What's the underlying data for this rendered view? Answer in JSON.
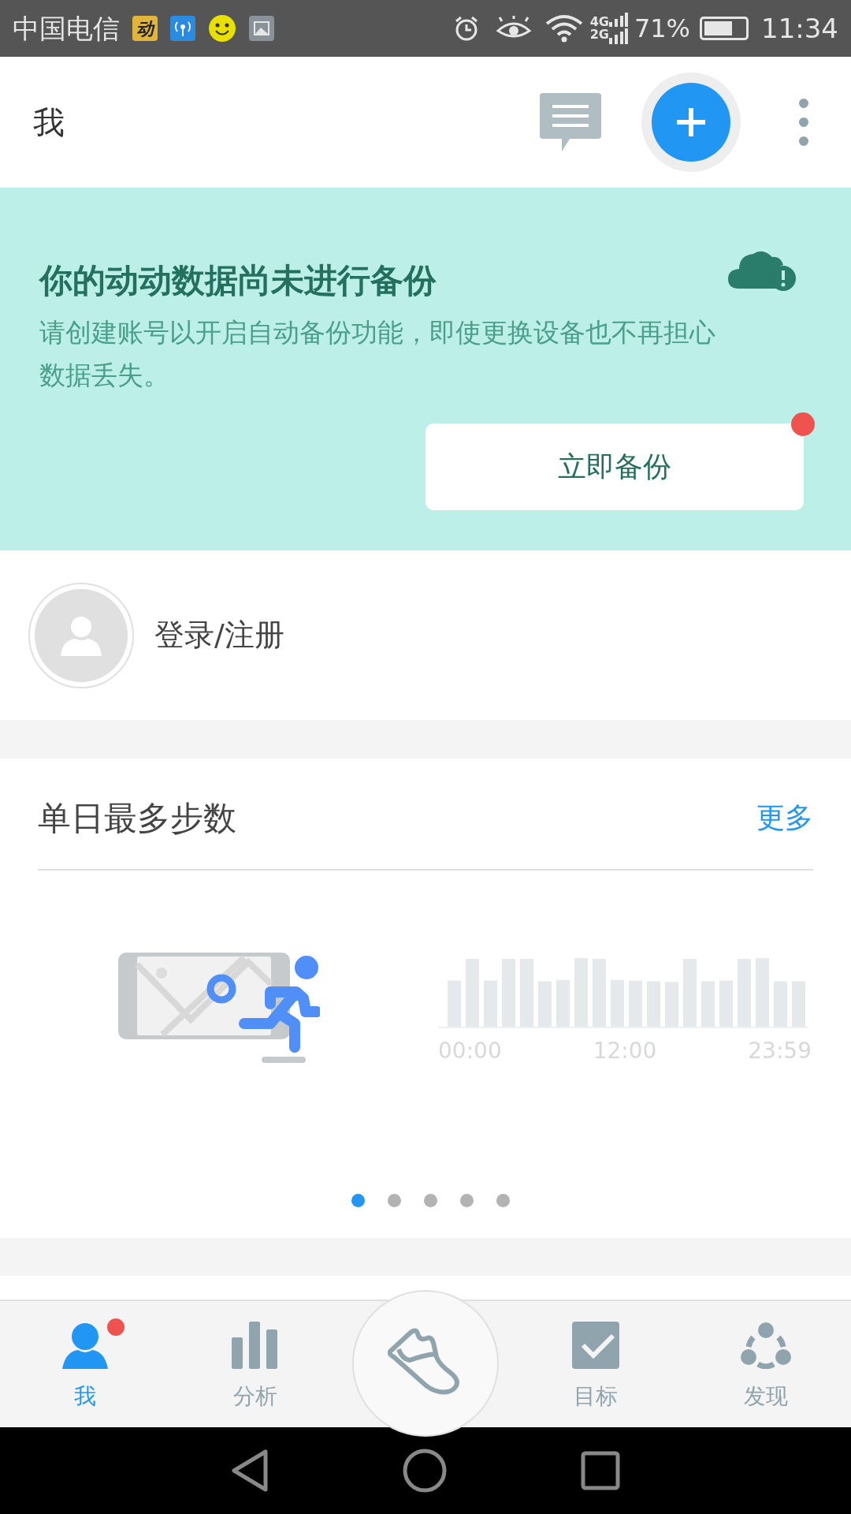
{
  "status_bar": {
    "carrier": "中国电信",
    "app_icon_label": "动",
    "network_top": "4G",
    "network_bottom": "2G",
    "battery": "71%",
    "time": "11:34"
  },
  "header": {
    "title": "我"
  },
  "backup_banner": {
    "title": "你的动动数据尚未进行备份",
    "text": "请创建账号以开启自动备份功能，即使更换设备也不再担心数据丢失。",
    "button": {
      "label": "立即备份",
      "badge": true
    }
  },
  "profile": {
    "label": "登录/注册"
  },
  "steps_card": {
    "title": "单日最多步数",
    "more": "更多",
    "axis_labels": [
      "00:00",
      "12:00",
      "23:59"
    ],
    "pages": [
      {
        "selected": true
      },
      {
        "selected": false
      },
      {
        "selected": false
      },
      {
        "selected": false
      },
      {
        "selected": false
      }
    ]
  },
  "bottom_nav": [
    {
      "kind": "person",
      "label": "我",
      "selected": true,
      "badge": true
    },
    {
      "kind": "bars",
      "label": "分析",
      "selected": false,
      "badge": false
    },
    {
      "kind": "shoe",
      "selected": false,
      "badge": false
    },
    {
      "kind": "check",
      "label": "目标",
      "selected": false,
      "badge": false
    },
    {
      "kind": "discover",
      "label": "发现",
      "selected": false,
      "badge": false
    }
  ]
}
